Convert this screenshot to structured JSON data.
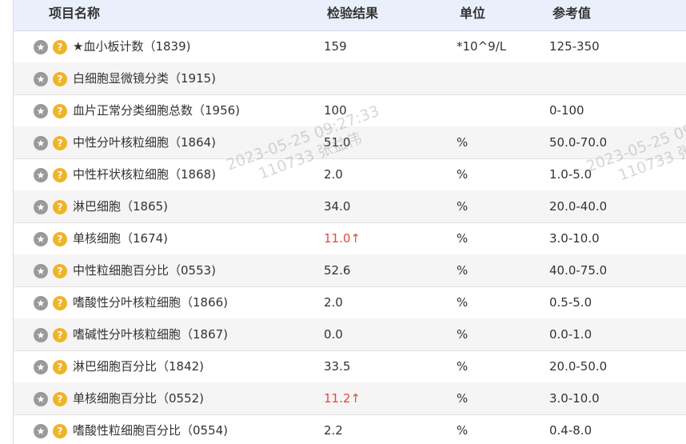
{
  "headers": {
    "name": "项目名称",
    "result": "检验结果",
    "unit": "单位",
    "ref": "参考值"
  },
  "icons": {
    "star": "star-icon",
    "help": "question-mark-icon"
  },
  "colors": {
    "header_bg": "#eaf0fb",
    "high_value": "#e8483b",
    "help_icon": "#f0b429",
    "star_icon": "#9a9a9a"
  },
  "rows": [
    {
      "name": "★血小板计数（1839)",
      "result": "159",
      "unit": "*10^9/L",
      "ref": "125-350",
      "flag": ""
    },
    {
      "name": "白细胞显微镜分类（1915)",
      "result": "",
      "unit": "",
      "ref": "",
      "flag": ""
    },
    {
      "name": "血片正常分类细胞总数（1956)",
      "result": "100",
      "unit": "",
      "ref": "0-100",
      "flag": ""
    },
    {
      "name": "中性分叶核粒细胞（1864)",
      "result": "51.0",
      "unit": "%",
      "ref": "50.0-70.0",
      "flag": ""
    },
    {
      "name": "中性杆状核粒细胞（1868)",
      "result": "2.0",
      "unit": "%",
      "ref": "1.0-5.0",
      "flag": ""
    },
    {
      "name": "淋巴细胞（1865)",
      "result": "34.0",
      "unit": "%",
      "ref": "20.0-40.0",
      "flag": ""
    },
    {
      "name": "单核细胞（1674)",
      "result": "11.0",
      "unit": "%",
      "ref": "3.0-10.0",
      "flag": "↑"
    },
    {
      "name": "中性粒细胞百分比（0553)",
      "result": "52.6",
      "unit": "%",
      "ref": "40.0-75.0",
      "flag": ""
    },
    {
      "name": "嗜酸性分叶核粒细胞（1866)",
      "result": "2.0",
      "unit": "%",
      "ref": "0.5-5.0",
      "flag": ""
    },
    {
      "name": "嗜碱性分叶核粒细胞（1867)",
      "result": "0.0",
      "unit": "%",
      "ref": "0.0-1.0",
      "flag": ""
    },
    {
      "name": "淋巴细胞百分比（1842)",
      "result": "33.5",
      "unit": "%",
      "ref": "20.0-50.0",
      "flag": ""
    },
    {
      "name": "单核细胞百分比（0552)",
      "result": "11.2",
      "unit": "%",
      "ref": "3.0-10.0",
      "flag": "↑"
    },
    {
      "name": "嗜酸性粒细胞百分比（0554)",
      "result": "2.2",
      "unit": "%",
      "ref": "0.4-8.0",
      "flag": ""
    }
  ],
  "watermarks": [
    {
      "line1": "2023-05-25 09:27:33",
      "line2": "110733 张益伟"
    },
    {
      "line1": "2023-05-25 09",
      "line2": "110733 张"
    }
  ]
}
